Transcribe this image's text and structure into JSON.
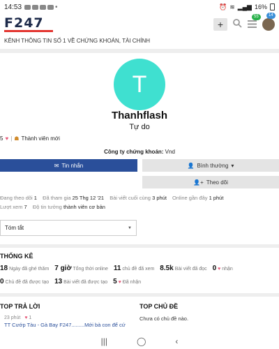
{
  "status_bar": {
    "time": "14:53",
    "battery": "16%"
  },
  "header": {
    "logo": "F247",
    "badges": {
      "notifications": "55",
      "messages": "14"
    },
    "tagline": "KÊNH THÔNG TIN SỐ 1 VỀ CHỨNG KHOÁN, TÀI CHÍNH"
  },
  "profile": {
    "avatar_letter": "T",
    "username": "Thanhflash",
    "user_title": "Tự do",
    "reputation": "5",
    "rank": "Thành viên mới",
    "company_label": "Công ty chứng khoán:",
    "company_value": "Vnd"
  },
  "buttons": {
    "message": "Tin nhắn",
    "normal": "Bình thường",
    "follow": "Theo dõi"
  },
  "info": {
    "following_label": "Đang theo dõi",
    "following_value": "1",
    "joined_label": "Đã tham gia",
    "joined_value": "25 Thg 12 '21",
    "last_post_label": "Bài viết cuối cùng",
    "last_post_value": "3 phút",
    "last_online_label": "Online gần đây",
    "last_online_value": "1 phút",
    "views_label": "Lượt xem",
    "views_value": "7",
    "trust_label": "Độ tin tưởng",
    "trust_value": "thành viên cơ bản"
  },
  "summary_select": {
    "selected": "Tóm tắt"
  },
  "stats": {
    "title": "THỐNG KÊ",
    "days_visited_value": "18",
    "days_visited_label": "Ngày đã ghé thăm",
    "time_read_value": "7 giờ",
    "time_read_label": "Tổng thời online",
    "topics_viewed_value": "11",
    "topics_viewed_label": "chủ đề đã xem",
    "posts_read_value": "8.5k",
    "posts_read_label": "Bài viết đã đọc",
    "likes_received_value": "0",
    "likes_received_label": "nhận",
    "topics_created_value": "0",
    "topics_created_label": "Chủ đề đã được tạo",
    "posts_created_value": "13",
    "posts_created_label": "Bài viết đã được tạo",
    "likes_given_value": "5",
    "likes_given_label": "Đã nhận"
  },
  "top_replies": {
    "title": "TOP TRẢ LỜI",
    "meta_time": "23 phút",
    "meta_likes": "1",
    "link": "TT Cướp Tàu - Gà Bay F247.........Mới bà con để cứ"
  },
  "top_topics": {
    "title": "TOP CHỦ ĐỀ",
    "empty": "Chưa có chủ đề nào."
  }
}
